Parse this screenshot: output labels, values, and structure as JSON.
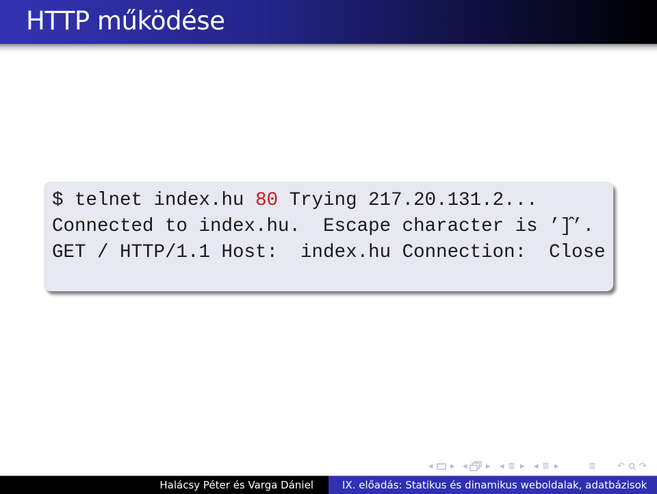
{
  "slide": {
    "title": "HTTP működése"
  },
  "code": {
    "line1_a": "$ telnet index.hu ",
    "line1_port": "80",
    "line1_b": " Trying 217.20.131.2...",
    "line2": "Connected to index.hu.  Escape character is ’]̂’.",
    "line3": "GET / HTTP/1.1 Host:  index.hu Connection:  Close",
    "highlight_color": "#cc1a1a"
  },
  "navigation": {
    "icons": [
      "left-arrow-icon",
      "frame-icon",
      "right-arrow-icon",
      "left-arrow-icon",
      "frames-icon",
      "right-arrow-icon",
      "left-arrow-icon",
      "subsection-icon",
      "right-arrow-icon",
      "left-arrow-icon",
      "section-icon",
      "right-arrow-icon",
      "appendix-icon",
      "undo-icon",
      "search-icon",
      "redo-icon"
    ]
  },
  "footer": {
    "authors": "Halácsy Péter és Varga Dániel",
    "lecture": "IX. előadás: Statikus és dinamikus weboldalak, adatbázisok"
  },
  "colors": {
    "title_bar": "#3333b2",
    "code_background": "#e8e8f3",
    "footer_right": "#3030b0",
    "footer_left": "#000000"
  }
}
